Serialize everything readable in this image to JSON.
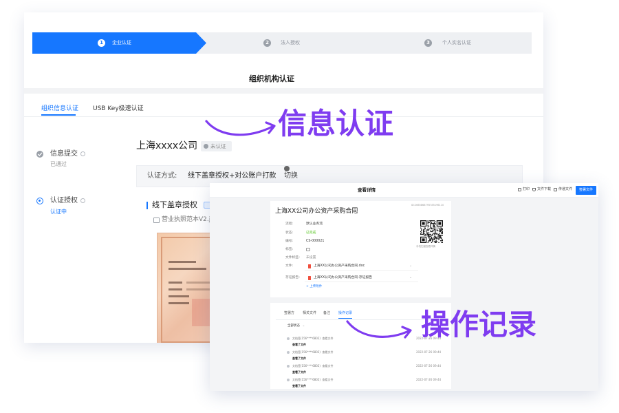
{
  "back_window": {
    "stepper": [
      {
        "number": "1",
        "label": "企业认证"
      },
      {
        "number": "2",
        "label": "法人授权"
      },
      {
        "number": "3",
        "label": "个人实名认证"
      }
    ],
    "title": "组织机构认证",
    "tabs": [
      {
        "label": "组织信息认证",
        "active": true
      },
      {
        "label": "USB Key极速认证",
        "active": false
      }
    ],
    "steps": [
      {
        "label": "信息提交",
        "status": "已通过"
      },
      {
        "label": "认证授权",
        "status": "认证中"
      }
    ],
    "company_name": "上海xxxx公司",
    "company_badge": "未认证",
    "method": {
      "label": "认证方式:",
      "value": "线下盖章授权+对公账户打款",
      "switch_label": "切换"
    },
    "section_title": "线下盖章授权",
    "license_file": "营业执照范本V2.jp"
  },
  "front_window": {
    "header_title": "查看详情",
    "toolbar": {
      "print": "打印",
      "download": "文件下载",
      "transfer": "传递文件",
      "primary_button": "签署文件"
    },
    "contract": {
      "title": "上海XX公司办公资产采购合同",
      "id": "ID:2665868795785196110",
      "fields": [
        {
          "label": "流程:",
          "value": "默认业务流"
        },
        {
          "label": "状态:",
          "value": "已完成"
        },
        {
          "label": "编号:",
          "value": "CS-000021"
        },
        {
          "label": "标签:"
        },
        {
          "label": "文件标签:",
          "value": "未设置"
        }
      ],
      "files": [
        {
          "label": "文件:",
          "name": "上海XX公司办公资产采购合同.doc"
        },
        {
          "label": "存证报告:",
          "name": "上海XX公司办公资产采购合同-存证报告"
        }
      ],
      "upload_label": "+ 上传附件",
      "qr_caption": "手机扫描查看详情"
    },
    "record_tabs": [
      {
        "label": "签署方",
        "active": false
      },
      {
        "label": "相关文件",
        "active": false
      },
      {
        "label": "备注",
        "active": false
      },
      {
        "label": "操作记录",
        "active": true
      }
    ],
    "filter": "全部状态",
    "records": [
      {
        "actor": "文档签(156****6802)",
        "action": "查看文件",
        "detail": "查看了文件",
        "time": "2022-07-26 09:44"
      },
      {
        "actor": "文档签(156****6802)",
        "action": "查看文件",
        "detail": "查看了文件",
        "time": "2022-07-26 09:44"
      },
      {
        "actor": "文档签(156****6802)",
        "action": "查看文件",
        "detail": "查看了文件",
        "time": "2022-07-26 09:44"
      },
      {
        "actor": "文档签(156****6802)",
        "action": "查看文件",
        "detail": "查看了文件",
        "time": "2022-07-26 09:44"
      }
    ]
  },
  "annotations": {
    "info": "信息认证",
    "records": "操作记录"
  },
  "colors": {
    "primary": "#1677ff",
    "annotation": "#7f3cf0",
    "success": "#52c41a",
    "stepper_track": "#eef0f3"
  }
}
